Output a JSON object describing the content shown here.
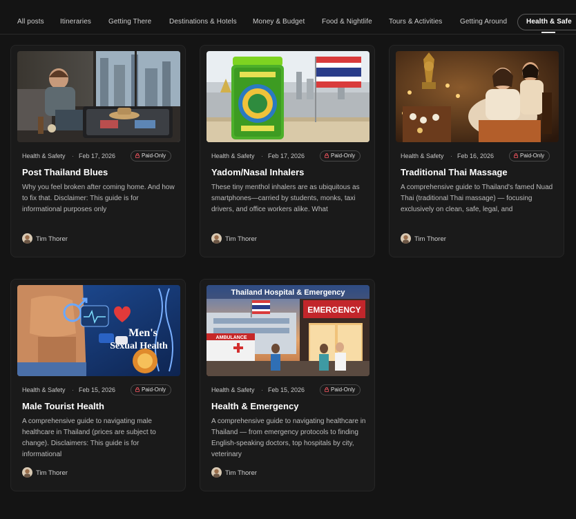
{
  "tabs": [
    {
      "label": "All posts"
    },
    {
      "label": "Itineraries"
    },
    {
      "label": "Getting There"
    },
    {
      "label": "Destinations & Hotels"
    },
    {
      "label": "Money & Budget"
    },
    {
      "label": "Food & Nightlife"
    },
    {
      "label": "Tours & Activities"
    },
    {
      "label": "Getting Around"
    },
    {
      "label": "Health & Safe"
    }
  ],
  "posts": [
    {
      "category": "Health & Safety",
      "date": "Feb 17, 2026",
      "badge": "Paid-Only",
      "title": "Post Thailand Blues",
      "excerpt": "Why you feel broken after coming home. And how to fix that. Disclaimer: This guide is for informational purposes only",
      "author": "Tim Thorer"
    },
    {
      "category": "Health & Safety",
      "date": "Feb 17, 2026",
      "badge": "Paid-Only",
      "title": "Yadom/Nasal Inhalers",
      "excerpt": "These tiny menthol inhalers are as ubiquitous as smartphones—carried by students, monks, taxi drivers, and office workers alike. What",
      "author": "Tim Thorer"
    },
    {
      "category": "Health & Safety",
      "date": "Feb 16, 2026",
      "badge": "Paid-Only",
      "title": "Traditional Thai Massage",
      "excerpt": "A comprehensive guide to Thailand's famed Nuad Thai (traditional Thai massage) — focusing exclusively on clean, safe, legal, and",
      "author": "Tim Thorer"
    },
    {
      "category": "Health & Safety",
      "date": "Feb 15, 2026",
      "badge": "Paid-Only",
      "title": "Male Tourist Health",
      "excerpt": "A comprehensive guide to navigating male healthcare in Thailand (prices are subject to change). Disclaimers: This guide is for informational",
      "author": "Tim Thorer",
      "image_text": [
        "Men's",
        "Sexual Health"
      ]
    },
    {
      "category": "Health & Safety",
      "date": "Feb 15, 2026",
      "badge": "Paid-Only",
      "title": "Health & Emergency",
      "excerpt": "A comprehensive guide to navigating healthcare in Thailand — from emergency protocols to finding English-speaking doctors, top hospitals by city, veterinary",
      "author": "Tim Thorer",
      "image_text": [
        "Thailand Hospital & Emergency",
        "EMERGENCY",
        "AMBULANCE"
      ]
    }
  ],
  "colors": {
    "background": "#141414",
    "card": "#1a1a1a",
    "badge_lock": "#e0505a"
  }
}
